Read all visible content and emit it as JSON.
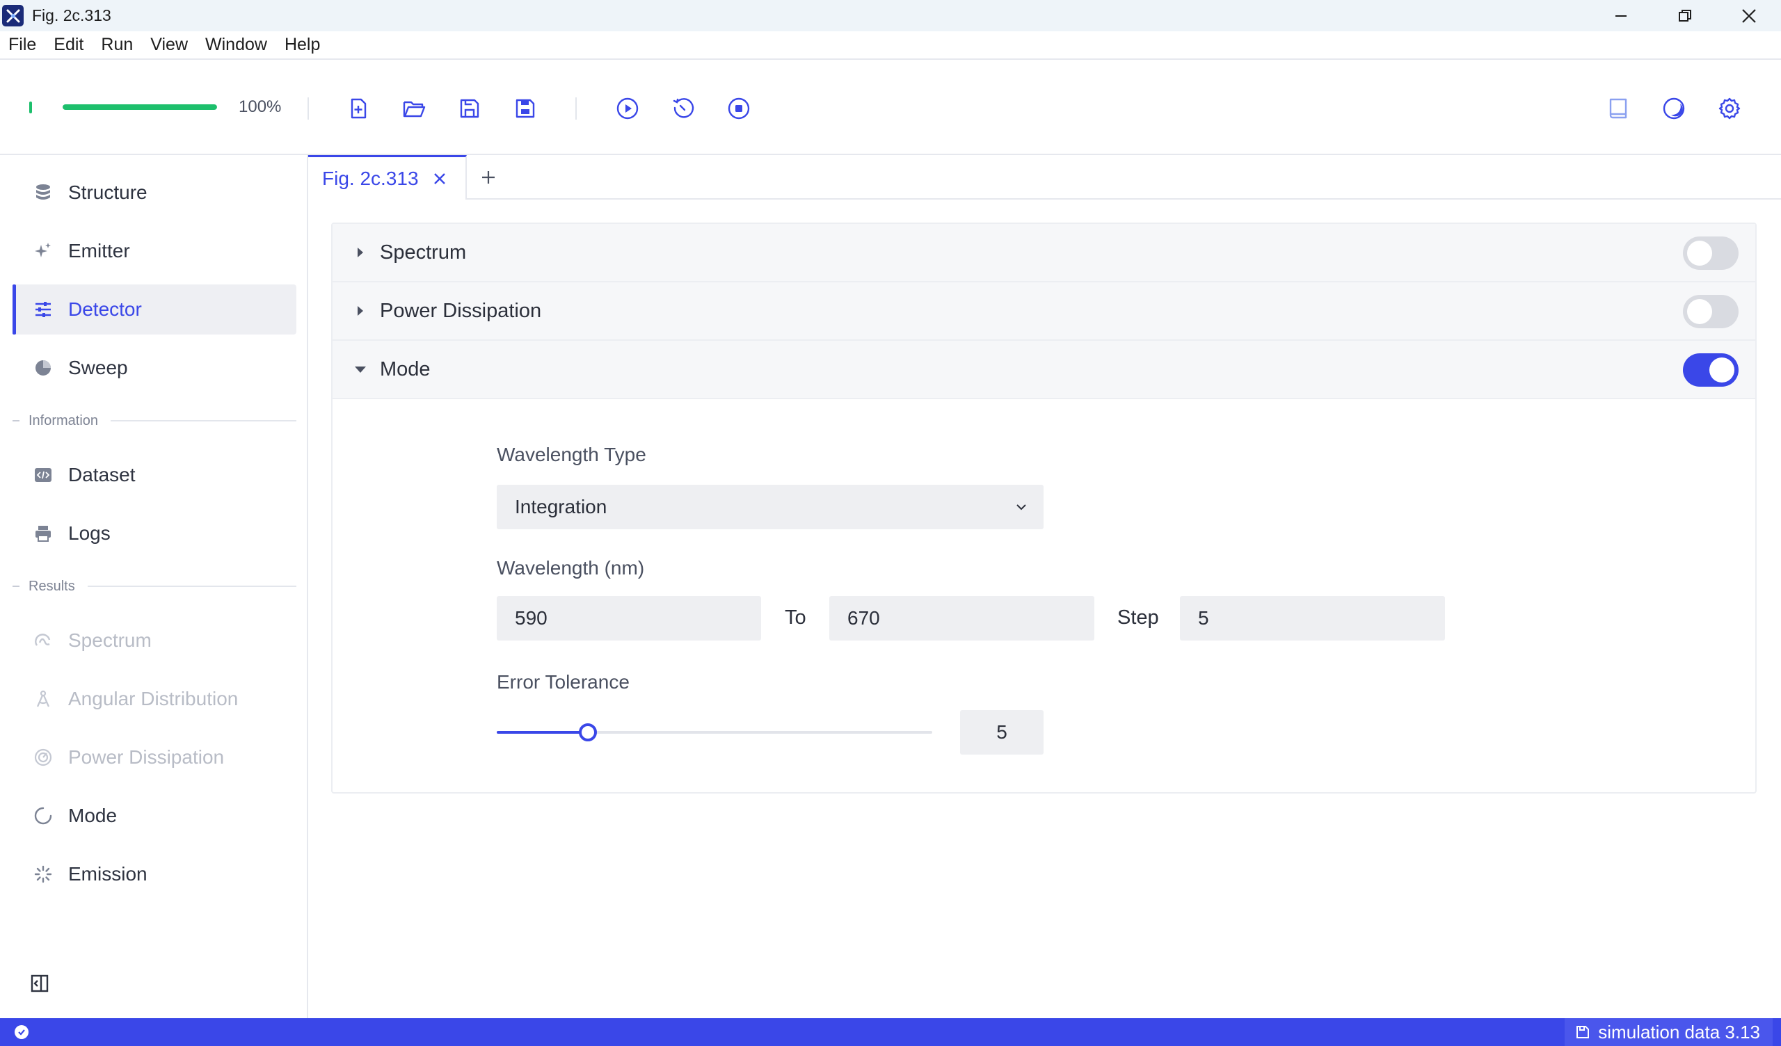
{
  "window": {
    "title": "Fig. 2c.313"
  },
  "menu": [
    "File",
    "Edit",
    "Run",
    "View",
    "Window",
    "Help"
  ],
  "toolbar": {
    "progress_percent": 100,
    "progress_text": "100%",
    "icons": [
      "new-file-icon",
      "open-folder-icon",
      "save-icon",
      "save-as-icon",
      "run-icon",
      "history-icon",
      "stop-icon",
      "book-icon",
      "theme-icon",
      "settings-icon"
    ]
  },
  "sidebar": {
    "items": [
      {
        "label": "Structure",
        "icon": "database-icon"
      },
      {
        "label": "Emitter",
        "icon": "sparkle-icon"
      },
      {
        "label": "Detector",
        "icon": "sliders-icon",
        "active": true
      },
      {
        "label": "Sweep",
        "icon": "pie-icon"
      }
    ],
    "section_information": "Information",
    "info_items": [
      {
        "label": "Dataset",
        "icon": "code-icon"
      },
      {
        "label": "Logs",
        "icon": "printer-icon"
      }
    ],
    "section_results": "Results",
    "result_items": [
      {
        "label": "Spectrum",
        "icon": "spectrum-icon",
        "disabled": true
      },
      {
        "label": "Angular Distribution",
        "icon": "compass-icon",
        "disabled": true
      },
      {
        "label": "Power Dissipation",
        "icon": "power-icon",
        "disabled": true
      },
      {
        "label": "Mode",
        "icon": "circle-arrow-icon"
      },
      {
        "label": "Emission",
        "icon": "loader-icon"
      }
    ]
  },
  "tabs": [
    {
      "label": "Fig. 2c.313",
      "active": true
    }
  ],
  "panel": {
    "sections": [
      {
        "title": "Spectrum",
        "enabled": false,
        "expanded": false
      },
      {
        "title": "Power Dissipation",
        "enabled": false,
        "expanded": false
      },
      {
        "title": "Mode",
        "enabled": true,
        "expanded": true
      }
    ],
    "mode": {
      "wavelength_type_label": "Wavelength Type",
      "wavelength_type_value": "Integration",
      "wavelength_label": "Wavelength (nm)",
      "wavelength_from": "590",
      "to_label": "To",
      "wavelength_to": "670",
      "step_label": "Step",
      "step_value": "5",
      "error_tolerance_label": "Error Tolerance",
      "error_tolerance_value": "5",
      "error_tolerance_fraction": 0.21
    }
  },
  "status": {
    "right_text": "simulation data 3.13"
  },
  "colors": {
    "accent": "#3a47e8",
    "progress": "#1dbf6c",
    "statusbar": "#3a47e8"
  }
}
